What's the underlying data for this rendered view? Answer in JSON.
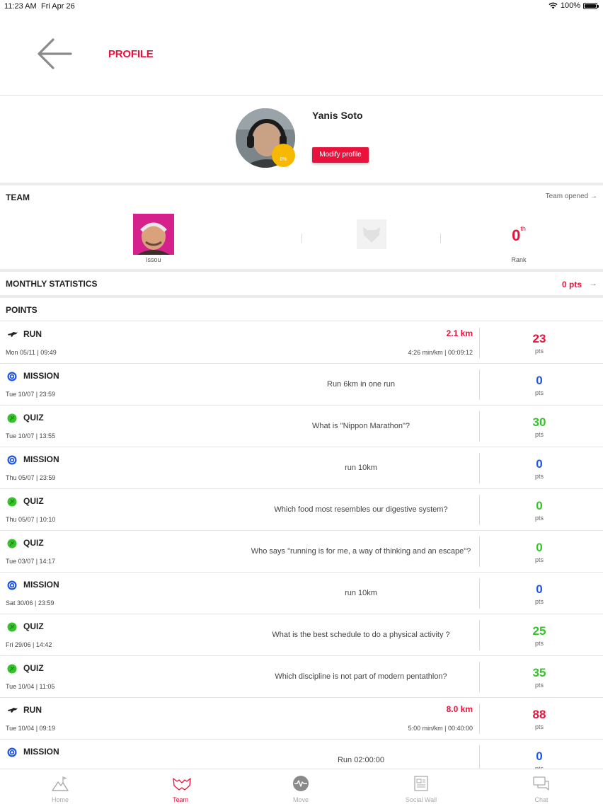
{
  "status": {
    "time": "11:23 AM",
    "date": "Fri Apr 26",
    "battery": "100%"
  },
  "header": {
    "title": "PROFILE"
  },
  "profile": {
    "name": "Yanis Soto",
    "progress": "0%",
    "modify_label": "Modify profile"
  },
  "team": {
    "title": "TEAM",
    "opened_label": "Team opened",
    "member_name": "issou",
    "rank_value": "0",
    "rank_suffix": "th",
    "rank_label": "Rank"
  },
  "monthly": {
    "title": "MONTHLY STATISTICS",
    "points": "0 pts"
  },
  "points_title": "POINTS",
  "colors": {
    "accent": "#e8123c",
    "mission": "#1f55e0",
    "quiz": "#36c22a",
    "run": "#e8123c"
  },
  "entries": [
    {
      "type": "run",
      "kind": "RUN",
      "date": "Mon 05/11 | 09:49",
      "distance": "2.1 km",
      "pace": "4:26 min/km | 00:09:12",
      "points": "23",
      "unit": "pts"
    },
    {
      "type": "mission",
      "kind": "MISSION",
      "date": "Tue 10/07 | 23:59",
      "desc": "Run 6km in one run",
      "points": "0",
      "unit": "pts"
    },
    {
      "type": "quiz",
      "kind": "QUIZ",
      "date": "Tue 10/07 | 13:55",
      "desc": "What is \"Nippon Marathon\"?",
      "points": "30",
      "unit": "pts"
    },
    {
      "type": "mission",
      "kind": "MISSION",
      "date": "Thu 05/07 | 23:59",
      "desc": "run 10km",
      "points": "0",
      "unit": "pts"
    },
    {
      "type": "quiz",
      "kind": "QUIZ",
      "date": "Thu 05/07 | 10:10",
      "desc": "Which food most resembles our digestive system?",
      "points": "0",
      "unit": "pts"
    },
    {
      "type": "quiz",
      "kind": "QUIZ",
      "date": "Tue 03/07 | 14:17",
      "desc": "Who says \"running is for me, a way of thinking and an escape\"?",
      "points": "0",
      "unit": "pts"
    },
    {
      "type": "mission",
      "kind": "MISSION",
      "date": "Sat 30/06 | 23:59",
      "desc": "run 10km",
      "points": "0",
      "unit": "pts"
    },
    {
      "type": "quiz",
      "kind": "QUIZ",
      "date": "Fri 29/06 | 14:42",
      "desc": "What is the best schedule to do a physical activity ?",
      "points": "25",
      "unit": "pts"
    },
    {
      "type": "quiz",
      "kind": "QUIZ",
      "date": "Tue 10/04 | 11:05",
      "desc": "Which discipline is not part of modern pentathlon?",
      "points": "35",
      "unit": "pts"
    },
    {
      "type": "run",
      "kind": "RUN",
      "date": "Tue 10/04 | 09:19",
      "distance": "8.0 km",
      "pace": "5:00 min/km | 00:40:00",
      "points": "88",
      "unit": "pts"
    },
    {
      "type": "mission",
      "kind": "MISSION",
      "date": "",
      "desc": "Run 02:00:00",
      "points": "0",
      "unit": "pts"
    }
  ],
  "tabs": [
    {
      "label": "Home",
      "icon": "home-mountain-icon"
    },
    {
      "label": "Team",
      "icon": "team-wolf-icon",
      "active": true
    },
    {
      "label": "Move",
      "icon": "move-pulse-icon"
    },
    {
      "label": "Social Wall",
      "icon": "social-wall-icon"
    },
    {
      "label": "Chat",
      "icon": "chat-icon"
    }
  ]
}
